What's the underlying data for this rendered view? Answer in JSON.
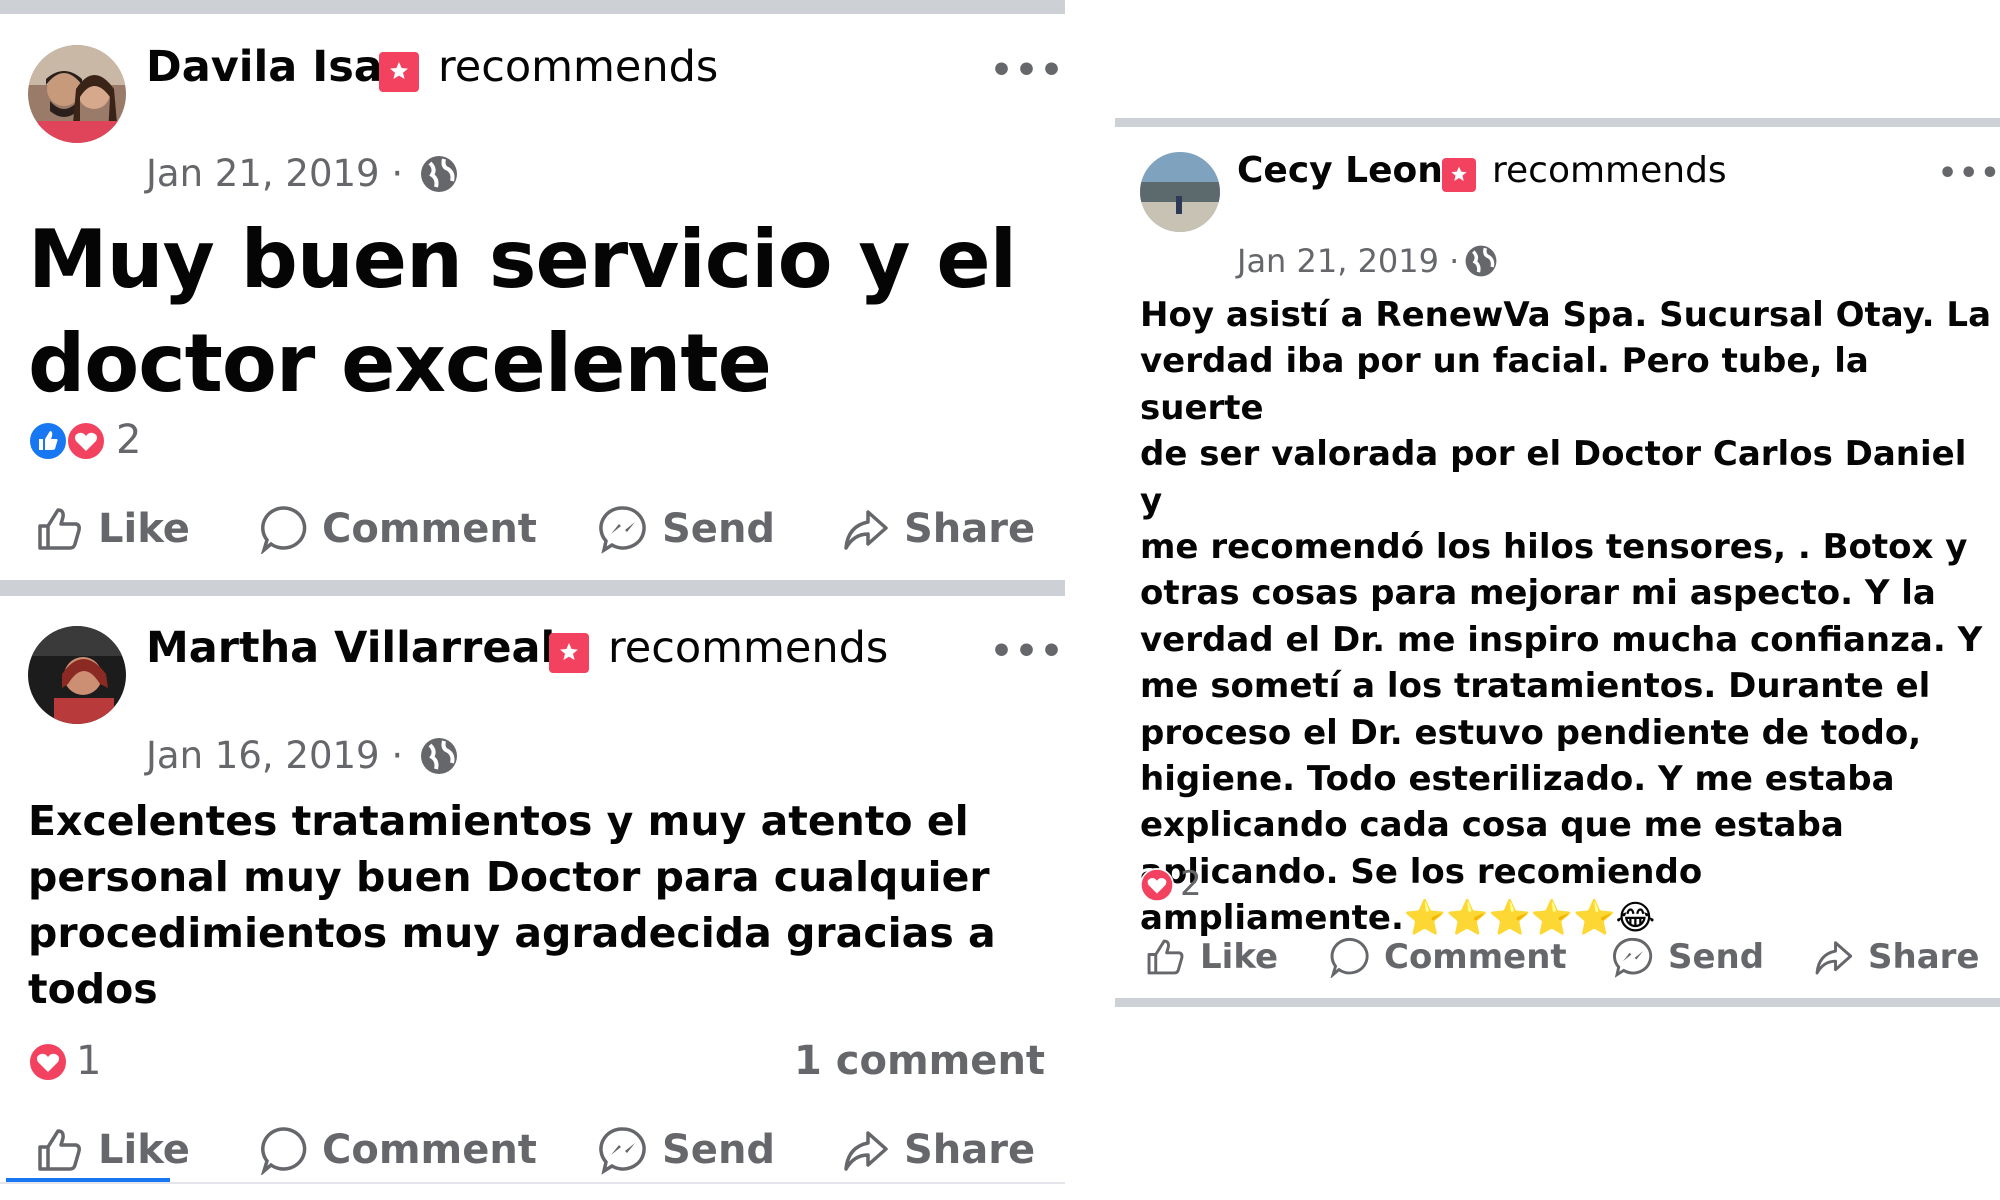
{
  "colors": {
    "divider": "#cdd0d5",
    "muted_text": "#65676b",
    "like_blue": "#1877f2",
    "love_red": "#f3425f",
    "recommend_badge": "#f3425f"
  },
  "actions": {
    "like": "Like",
    "comment": "Comment",
    "send": "Send",
    "share": "Share"
  },
  "posts": [
    {
      "author": "Davila Isa",
      "verb": "recommends",
      "date": "Jan 21, 2019 ·",
      "text": "Muy buen servicio y el\ndoctor excelente",
      "reactions": [
        "like",
        "love"
      ],
      "reaction_count": "2",
      "comments": ""
    },
    {
      "author": "Martha Villarreal",
      "verb": "recommends",
      "date": "Jan 16, 2019 ·",
      "text": "Excelentes tratamientos y muy atento el\npersonal muy buen Doctor para cualquier\nprocedimientos muy agradecida gracias a\ntodos",
      "reactions": [
        "love"
      ],
      "reaction_count": "1",
      "comments": "1 comment"
    },
    {
      "author": "Cecy Leon",
      "verb": "recommends",
      "date": "Jan 21, 2019 ·",
      "text": "Hoy asistí a RenewVa Spa. Sucursal Otay. La\nverdad iba por un facial. Pero tube, la suerte\nde ser valorada por el Doctor Carlos Daniel y\nme recomendó los hilos tensores, . Botox  y\notras cosas para mejorar mi aspecto. Y la\nverdad el Dr. me inspiro mucha confianza. Y\nme sometí a los tratamientos. Durante el\nproceso el Dr. estuvo pendiente de todo,\nhigiene. Todo esterilizado. Y me estaba\nexplicando cada cosa que me estaba\naplicando. Se los recomiendo\nampliamente.⭐⭐⭐⭐⭐😂",
      "reactions": [
        "love"
      ],
      "reaction_count": "2",
      "comments": ""
    }
  ]
}
